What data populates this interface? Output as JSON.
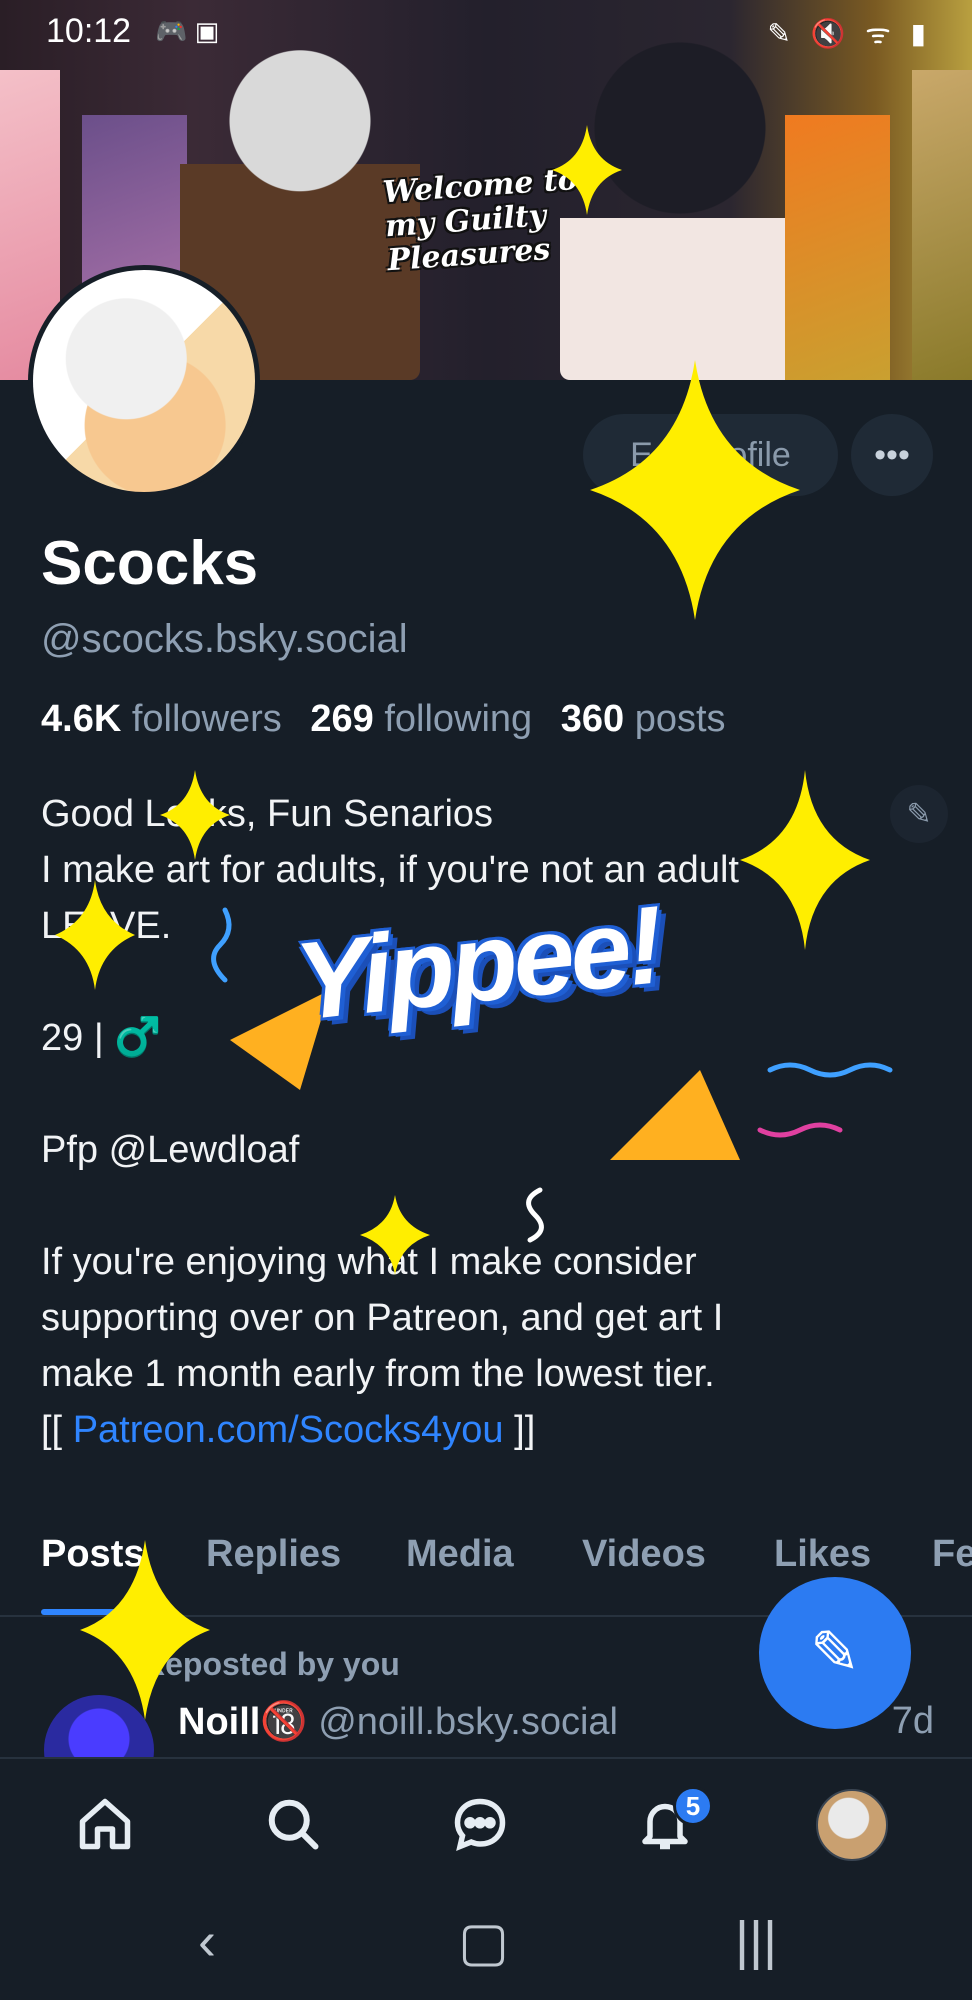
{
  "statusbar": {
    "time": "10:12"
  },
  "banner": {
    "text": "Welcome to my Guilty Pleasures"
  },
  "profile": {
    "edit_label": "Edit profile",
    "more_label": "•••",
    "name": "Scocks",
    "handle": "@scocks.bsky.social",
    "stats": {
      "followers_count": "4.6K",
      "followers_label": "followers",
      "following_count": "269",
      "following_label": "following",
      "posts_count": "360",
      "posts_label": "posts"
    },
    "bio": {
      "line1": "Good Looks, Fun Senarios",
      "line2": "I make art for adults, if you're not an adult",
      "line3": "LEAVE.",
      "line4": "29 | ♂️",
      "line5": "Pfp @Lewdloaf",
      "line6": "If you're enjoying what I make consider",
      "line7": "supporting over on Patreon, and get art I",
      "line8": "make 1 month early from the lowest tier.",
      "line9_prefix": "[[ ",
      "link": "Patreon.com/Scocks4you",
      "line9_suffix": " ]]"
    }
  },
  "tabs": [
    "Posts",
    "Replies",
    "Media",
    "Videos",
    "Likes",
    "Fe"
  ],
  "post": {
    "repost_label": "Reposted by you",
    "author": "Noill🔞",
    "handle": "@noill.bsky.social",
    "time": "7d"
  },
  "nav": {
    "notifications_badge": "5"
  },
  "sticker": {
    "text": "Yippee!"
  },
  "colors": {
    "accent": "#2f85ff",
    "background": "#161e27",
    "muted": "#8e9fb2",
    "sparkle": "#ffee00"
  }
}
